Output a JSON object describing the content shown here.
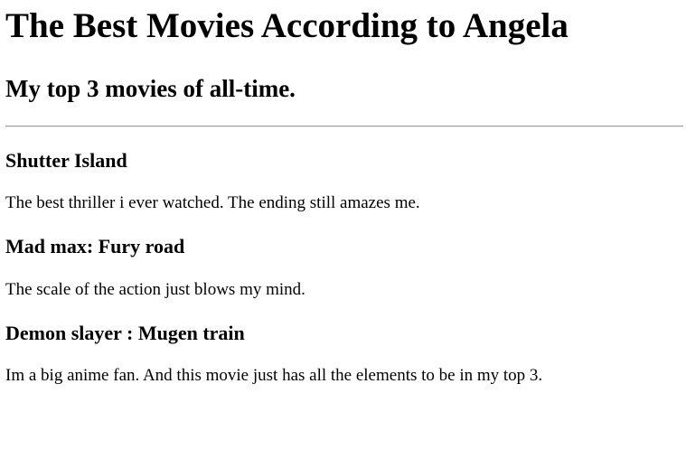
{
  "page": {
    "title": "The Best Movies According to Angela",
    "subtitle": "My top 3 movies of all-time."
  },
  "movies": [
    {
      "title": "Shutter Island",
      "description": "The best thriller i ever watched. The ending still amazes me."
    },
    {
      "title": "Mad max: Fury road",
      "description": "The scale of the action just blows my mind."
    },
    {
      "title": "Demon slayer : Mugen train",
      "description": "Im a big anime fan. And this movie just has all the elements to be in my top 3."
    }
  ]
}
